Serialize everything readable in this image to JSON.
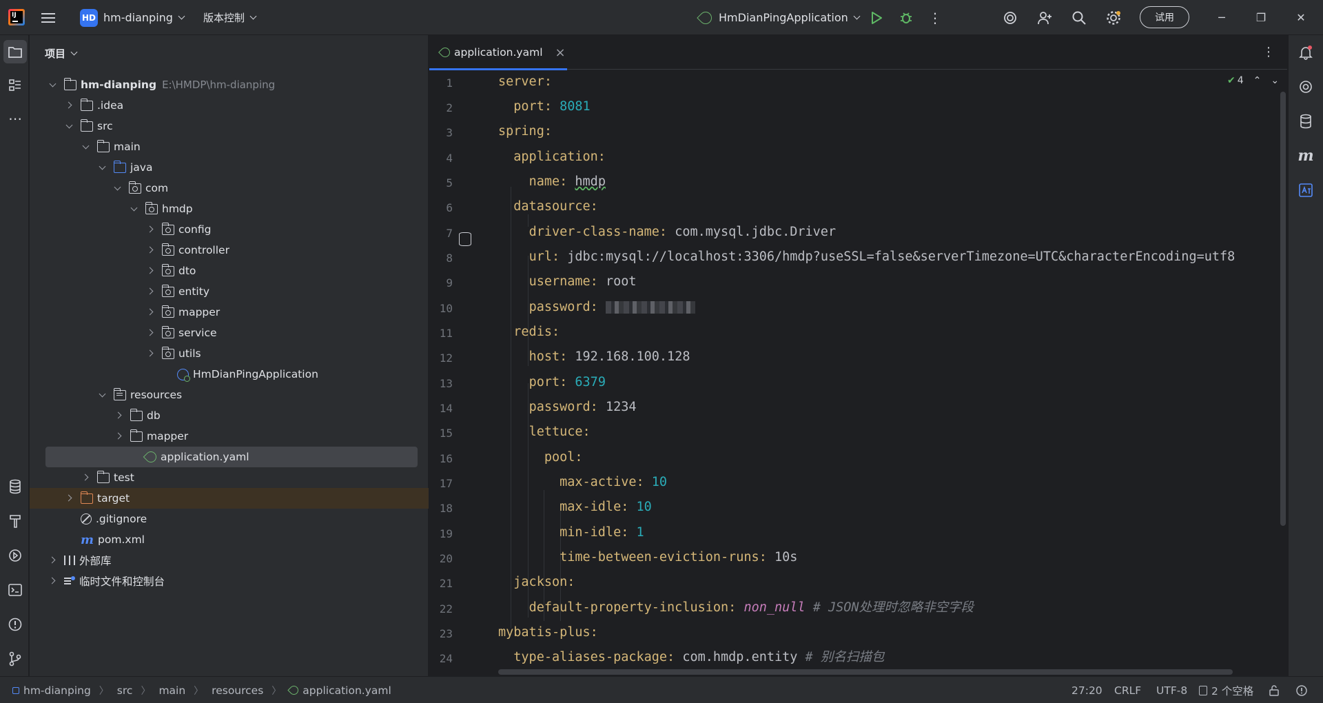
{
  "titlebar": {
    "logo_text": "IJ",
    "project_badge": "HD",
    "project_name": "hm-dianping",
    "vcs_menu": "版本控制",
    "run_config": "HmDianPingApplication",
    "trial_label": "试用"
  },
  "project_panel": {
    "title": "项目",
    "tree": [
      {
        "label": "hm-dianping",
        "hint": "E:\\HMDP\\hm-dianping"
      },
      {
        "label": ".idea"
      },
      {
        "label": "src"
      },
      {
        "label": "main"
      },
      {
        "label": "java"
      },
      {
        "label": "com"
      },
      {
        "label": "hmdp"
      },
      {
        "label": "config"
      },
      {
        "label": "controller"
      },
      {
        "label": "dto"
      },
      {
        "label": "entity"
      },
      {
        "label": "mapper"
      },
      {
        "label": "service"
      },
      {
        "label": "utils"
      },
      {
        "label": "HmDianPingApplication"
      },
      {
        "label": "resources"
      },
      {
        "label": "db"
      },
      {
        "label": "mapper"
      },
      {
        "label": "application.yaml"
      },
      {
        "label": "test"
      },
      {
        "label": "target"
      },
      {
        "label": ".gitignore"
      },
      {
        "label": "pom.xml"
      },
      {
        "label": "外部库"
      },
      {
        "label": "临时文件和控制台"
      }
    ]
  },
  "editor": {
    "tab_label": "application.yaml",
    "inspection_count": "4",
    "line_numbers": [
      "1",
      "2",
      "3",
      "4",
      "5",
      "6",
      "7",
      "8",
      "9",
      "10",
      "11",
      "12",
      "13",
      "14",
      "15",
      "16",
      "17",
      "18",
      "19",
      "20",
      "21",
      "22",
      "23",
      "24"
    ],
    "lines": [
      {
        "key": "server:"
      },
      {
        "key": "port:",
        "val": "8081"
      },
      {
        "key": "spring:"
      },
      {
        "key": "application:"
      },
      {
        "key": "name:",
        "val": "hmdp"
      },
      {
        "key": "datasource:"
      },
      {
        "key": "driver-class-name:",
        "val": "com.mysql.jdbc.Driver"
      },
      {
        "key": "url:",
        "val": "jdbc:mysql://localhost:3306/hmdp?useSSL=false&serverTimezone=UTC&characterEncoding=utf8"
      },
      {
        "key": "username:",
        "val": "root"
      },
      {
        "key": "password:"
      },
      {
        "key": "redis:"
      },
      {
        "key": "host:",
        "val": "192.168.100.128"
      },
      {
        "key": "port:",
        "val": "6379"
      },
      {
        "key": "password:",
        "val": "1234"
      },
      {
        "key": "lettuce:"
      },
      {
        "key": "pool:"
      },
      {
        "key": "max-active:",
        "val": "10"
      },
      {
        "key": "max-idle:",
        "val": "10"
      },
      {
        "key": "min-idle:",
        "val": "1"
      },
      {
        "key": "time-between-eviction-runs:",
        "val": "10s"
      },
      {
        "key": "jackson:"
      },
      {
        "key": "default-property-inclusion:",
        "val": "non_null",
        "comment": "# JSON处理时忽略非空字段"
      },
      {
        "key": "mybatis-plus:"
      },
      {
        "key": "type-aliases-package:",
        "val": "com.hmdp.entity",
        "comment": "# 别名扫描包"
      }
    ]
  },
  "statusbar": {
    "breadcrumb": [
      "hm-dianping",
      "src",
      "main",
      "resources",
      "application.yaml"
    ],
    "position": "27:20",
    "line_sep": "CRLF",
    "encoding": "UTF-8",
    "indent": "2 个空格"
  },
  "colors": {
    "accent": "#3574f0",
    "key": "#d5b778",
    "number": "#2aacb8",
    "comment": "#7a7e85"
  }
}
